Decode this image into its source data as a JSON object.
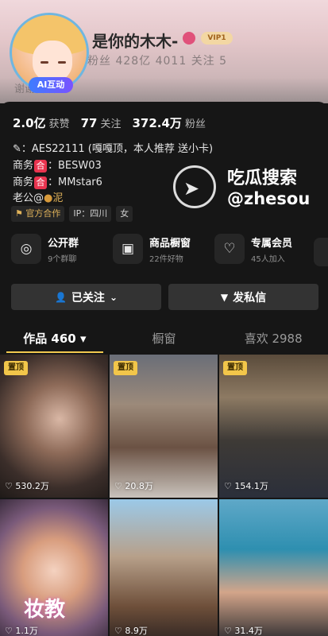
{
  "profile": {
    "nickname": "是你的木木-",
    "ai_badge": "AI互动",
    "vip_badge": "VIP1",
    "header_blur_line1": "粉丝 428亿  4011 关注 5",
    "header_blur_line2": "谢谢喜欢"
  },
  "stats": [
    {
      "value": "2.0亿",
      "label": "获赞"
    },
    {
      "value": "77",
      "label": "关注"
    },
    {
      "value": "372.4万",
      "label": "粉丝"
    }
  ],
  "bio": {
    "line1": "：AES22111 (嘎嘎顶，本人推荐 送小卡)",
    "line2_prefix": "商务",
    "line2_tag": "合",
    "line2_value": "：BESW03",
    "line3_prefix": "商务",
    "line3_tag": "合",
    "line3_value": "：MMstar6",
    "line4": "老公@",
    "line4_name": "泥"
  },
  "watermark": {
    "title": "吃瓜搜索",
    "handle": "@zhesou"
  },
  "chips": [
    "官方合作",
    "IP：四川",
    "女"
  ],
  "features": [
    {
      "title": "公开群",
      "sub": "9个群聊",
      "icon": "chat-icon"
    },
    {
      "title": "商品橱窗",
      "sub": "22件好物",
      "icon": "shop-icon"
    },
    {
      "title": "专属会员",
      "sub": "45人加入",
      "icon": "vip-icon"
    }
  ],
  "buttons": {
    "follow": "已关注",
    "message": "发私信"
  },
  "tabs": [
    {
      "label": "作品 460 ▾",
      "active": true
    },
    {
      "label": "橱窗",
      "active": false
    },
    {
      "label": "喜欢 2988",
      "active": false
    }
  ],
  "videos": [
    {
      "pinned": "置顶",
      "likes": "530.2万"
    },
    {
      "pinned": "置顶",
      "likes": "20.8万"
    },
    {
      "pinned": "置顶",
      "likes": "154.1万"
    },
    {
      "pinned": "",
      "likes": "1.1万",
      "overlay": "妆教"
    },
    {
      "pinned": "",
      "likes": "8.9万"
    },
    {
      "pinned": "",
      "likes": "31.4万"
    }
  ]
}
